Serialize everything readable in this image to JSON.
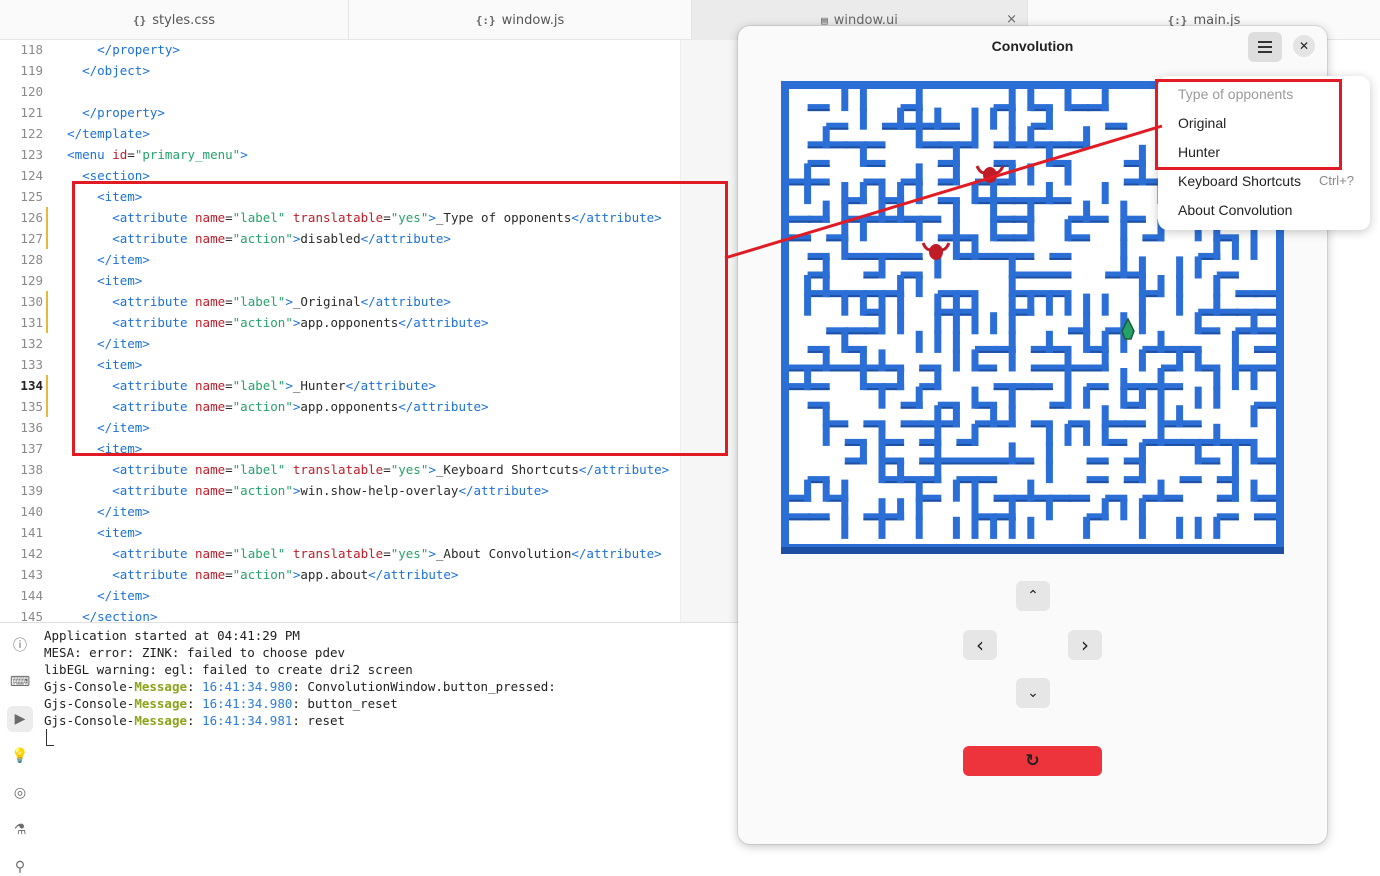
{
  "tabs": [
    {
      "glyph": "{}",
      "label": "styles.css"
    },
    {
      "glyph": "{:}",
      "label": "window.js"
    },
    {
      "glyph": "▤",
      "label": "window.ui",
      "close": "×"
    },
    {
      "glyph": "{:}",
      "label": "main.js"
    }
  ],
  "code": {
    "current_line": "134",
    "lines": [
      {
        "n": "118",
        "html": "      <span class=\"tg\">&lt;/property&gt;</span>"
      },
      {
        "n": "119",
        "html": "    <span class=\"tg\">&lt;/object&gt;</span>"
      },
      {
        "n": "120",
        "html": ""
      },
      {
        "n": "121",
        "html": "    <span class=\"tg\">&lt;/property&gt;</span>"
      },
      {
        "n": "122",
        "html": "  <span class=\"tg\">&lt;/template&gt;</span>"
      },
      {
        "n": "123",
        "html": "  <span class=\"tg\">&lt;menu</span> <span class=\"an\">id</span>=<span class=\"av\">\"primary_menu\"</span><span class=\"tg\">&gt;</span>"
      },
      {
        "n": "124",
        "html": "    <span class=\"tg\">&lt;section&gt;</span>"
      },
      {
        "n": "125",
        "html": "      <span class=\"tg\">&lt;item&gt;</span>"
      },
      {
        "n": "126",
        "html": "        <span class=\"tg\">&lt;attribute</span> <span class=\"an\">name</span>=<span class=\"av\">\"label\"</span> <span class=\"an\">translatable</span>=<span class=\"av\">\"yes\"</span><span class=\"tg\">&gt;</span>_Type of opponents<span class=\"tg\">&lt;/attribute&gt;</span>",
        "mark": true
      },
      {
        "n": "127",
        "html": "        <span class=\"tg\">&lt;attribute</span> <span class=\"an\">name</span>=<span class=\"av\">\"action\"</span><span class=\"tg\">&gt;</span>disabled<span class=\"tg\">&lt;/attribute&gt;</span>",
        "mark": true
      },
      {
        "n": "128",
        "html": "      <span class=\"tg\">&lt;/item&gt;</span>"
      },
      {
        "n": "129",
        "html": "      <span class=\"tg\">&lt;item&gt;</span>"
      },
      {
        "n": "130",
        "html": "        <span class=\"tg\">&lt;attribute</span> <span class=\"an\">name</span>=<span class=\"av\">\"label\"</span><span class=\"tg\">&gt;</span>_Original<span class=\"tg\">&lt;/attribute&gt;</span>",
        "mark": true
      },
      {
        "n": "131",
        "html": "        <span class=\"tg\">&lt;attribute</span> <span class=\"an\">name</span>=<span class=\"av\">\"action\"</span><span class=\"tg\">&gt;</span>app.opponents<span class=\"tg\">&lt;/attribute&gt;</span>",
        "mark": true
      },
      {
        "n": "132",
        "html": "      <span class=\"tg\">&lt;/item&gt;</span>"
      },
      {
        "n": "133",
        "html": "      <span class=\"tg\">&lt;item&gt;</span>"
      },
      {
        "n": "134",
        "html": "        <span class=\"tg\">&lt;attribute</span> <span class=\"an\">name</span>=<span class=\"av\">\"label\"</span><span class=\"tg\">&gt;</span>_Hunter<span class=\"tg\">&lt;/attribute&gt;</span>",
        "mark": true
      },
      {
        "n": "135",
        "html": "        <span class=\"tg\">&lt;attribute</span> <span class=\"an\">name</span>=<span class=\"av\">\"action\"</span><span class=\"tg\">&gt;</span>app.opponents<span class=\"tg\">&lt;/attribute&gt;</span>",
        "mark": true
      },
      {
        "n": "136",
        "html": "      <span class=\"tg\">&lt;/item&gt;</span>"
      },
      {
        "n": "137",
        "html": "      <span class=\"tg\">&lt;item&gt;</span>"
      },
      {
        "n": "138",
        "html": "        <span class=\"tg\">&lt;attribute</span> <span class=\"an\">name</span>=<span class=\"av\">\"label\"</span> <span class=\"an\">translatable</span>=<span class=\"av\">\"yes\"</span><span class=\"tg\">&gt;</span>_Keyboard Shortcuts<span class=\"tg\">&lt;/attribute&gt;</span>"
      },
      {
        "n": "139",
        "html": "        <span class=\"tg\">&lt;attribute</span> <span class=\"an\">name</span>=<span class=\"av\">\"action\"</span><span class=\"tg\">&gt;</span>win.show-help-overlay<span class=\"tg\">&lt;/attribute&gt;</span>"
      },
      {
        "n": "140",
        "html": "      <span class=\"tg\">&lt;/item&gt;</span>"
      },
      {
        "n": "141",
        "html": "      <span class=\"tg\">&lt;item&gt;</span>"
      },
      {
        "n": "142",
        "html": "        <span class=\"tg\">&lt;attribute</span> <span class=\"an\">name</span>=<span class=\"av\">\"label\"</span> <span class=\"an\">translatable</span>=<span class=\"av\">\"yes\"</span><span class=\"tg\">&gt;</span>_About Convolution<span class=\"tg\">&lt;/attribute&gt;</span>"
      },
      {
        "n": "143",
        "html": "        <span class=\"tg\">&lt;attribute</span> <span class=\"an\">name</span>=<span class=\"av\">\"action\"</span><span class=\"tg\">&gt;</span>app.about<span class=\"tg\">&lt;/attribute&gt;</span>"
      },
      {
        "n": "144",
        "html": "      <span class=\"tg\">&lt;/item&gt;</span>"
      },
      {
        "n": "145",
        "html": "    <span class=\"tg\">&lt;/section&gt;</span>"
      }
    ]
  },
  "console": {
    "lines": [
      {
        "parts": [
          {
            "t": "Application started at 04:41:29 PM"
          }
        ]
      },
      {
        "parts": [
          {
            "t": "MESA: error: ZINK: failed to choose pdev"
          }
        ]
      },
      {
        "parts": [
          {
            "t": "libEGL warning: egl: failed to create dri2 screen"
          }
        ]
      },
      {
        "parts": [
          {
            "t": "Gjs-Console-"
          },
          {
            "t": "Message",
            "c": "msg"
          },
          {
            "t": ": "
          },
          {
            "t": "16:41:34.980",
            "c": "ts"
          },
          {
            "t": ": ConvolutionWindow.button_pressed:"
          }
        ]
      },
      {
        "parts": [
          {
            "t": "Gjs-Console-"
          },
          {
            "t": "Message",
            "c": "msg"
          },
          {
            "t": ": "
          },
          {
            "t": "16:41:34.980",
            "c": "ts"
          },
          {
            "t": ": button_reset"
          }
        ]
      },
      {
        "parts": [
          {
            "t": "Gjs-Console-"
          },
          {
            "t": "Message",
            "c": "msg"
          },
          {
            "t": ": "
          },
          {
            "t": "16:41:34.981",
            "c": "ts"
          },
          {
            "t": ": reset"
          }
        ]
      }
    ],
    "side_icons": [
      "info-icon",
      "terminal-icon",
      "run-icon",
      "bulb-icon",
      "globe-icon",
      "flask-icon",
      "search-icon"
    ]
  },
  "app": {
    "title": "Convolution",
    "menu_button_icon": "hamburger-icon",
    "close_glyph": "✕",
    "up_glyph": "⌃",
    "left_glyph": "‹",
    "right_glyph": "›",
    "down_glyph": "⌄",
    "reset_glyph": "↻",
    "colors": {
      "maze_wall": "#2b6fd6",
      "reset_button": "#ed333b",
      "annotation": "#e01b24"
    }
  },
  "popover": {
    "items": [
      {
        "label": "Type of opponents",
        "disabled": true
      },
      {
        "label": "Original"
      },
      {
        "label": "Hunter"
      },
      {
        "label": "Keyboard Shortcuts",
        "accel": "Ctrl+?"
      },
      {
        "label": "About Convolution"
      }
    ]
  }
}
